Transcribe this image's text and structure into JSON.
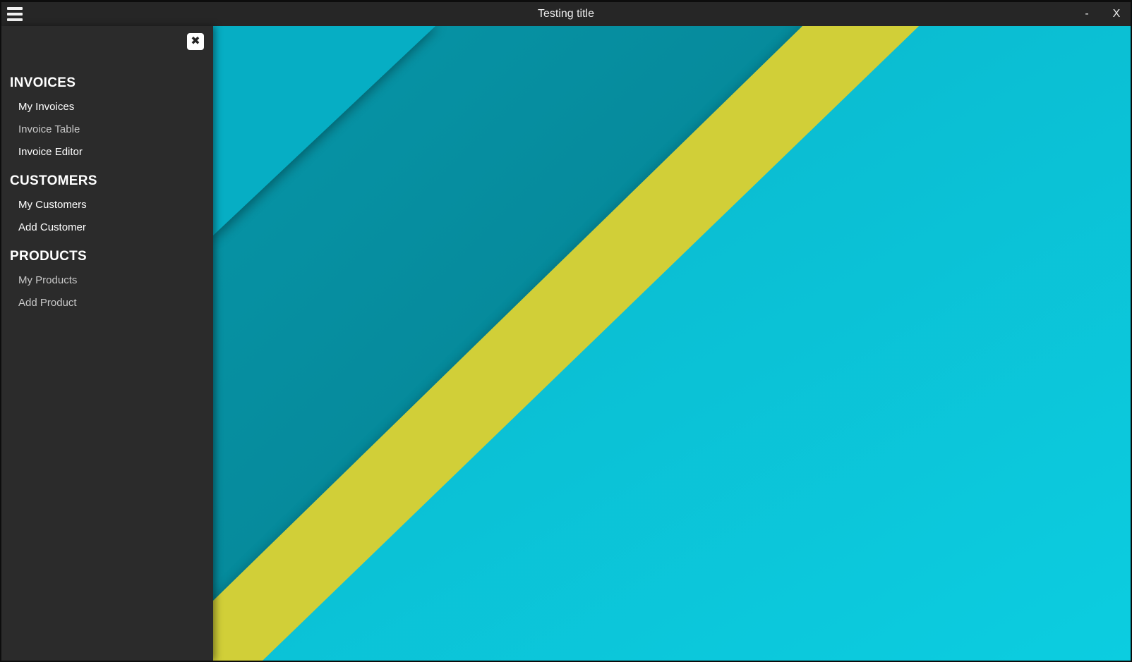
{
  "window": {
    "title": "Testing title",
    "minimize_label": "-",
    "close_label": "X"
  },
  "drawer": {
    "close_icon_glyph": "✖",
    "sections": [
      {
        "header": "INVOICES",
        "items": [
          {
            "label": "My Invoices",
            "dim": false
          },
          {
            "label": "Invoice Table",
            "dim": true
          },
          {
            "label": "Invoice Editor",
            "dim": false
          }
        ]
      },
      {
        "header": "CUSTOMERS",
        "items": [
          {
            "label": "My Customers",
            "dim": false
          },
          {
            "label": "Add Customer",
            "dim": false
          }
        ]
      },
      {
        "header": "PRODUCTS",
        "items": [
          {
            "label": "My Products",
            "dim": true
          },
          {
            "label": "Add Product",
            "dim": true
          }
        ]
      }
    ]
  },
  "colors": {
    "background_cyan": "#0bc0d6",
    "background_dark_teal": "#068ea0",
    "background_light_cyan": "#08b4cc",
    "stripe_yellow": "#d1cf38",
    "drawer_bg": "#2b2b2b",
    "titlebar_bg": "#262626"
  },
  "icons": {
    "menu": "hamburger-icon",
    "drawer_close": "close-icon"
  }
}
